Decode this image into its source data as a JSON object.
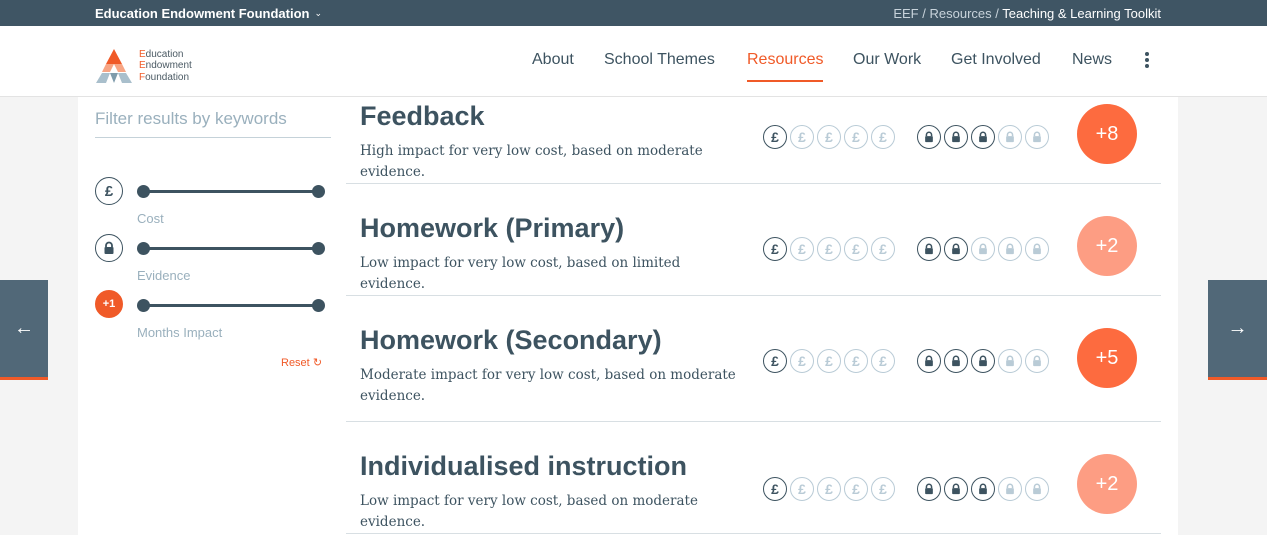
{
  "topbar": {
    "org_name": "Education Endowment Foundation",
    "breadcrumb_eef": "EEF",
    "breadcrumb_resources": "Resources",
    "breadcrumb_current": "Teaching & Learning Toolkit",
    "separator": " / "
  },
  "logo": {
    "line1": "Education",
    "line2": "Endowment",
    "line3": "Foundation",
    "accent": "#f05a28"
  },
  "nav": {
    "about": "About",
    "school_themes": "School Themes",
    "resources": "Resources",
    "our_work": "Our Work",
    "get_involved": "Get Involved",
    "news": "News",
    "active": "Resources"
  },
  "filters": {
    "keyword_placeholder": "Filter results by keywords",
    "cost_icon": "£",
    "cost_label": "Cost",
    "evidence_label": "Evidence",
    "impact_icon": "+1",
    "impact_label": "Months Impact",
    "reset_label": "Reset"
  },
  "icons": {
    "pound": "£",
    "prev_arrow": "←",
    "next_arrow": "→"
  },
  "colors": {
    "accent": "#f05a28",
    "dark": "#3d5360",
    "badge_high": "#fd6b3f",
    "badge_low": "#fd9d83",
    "inactive_icon": "#b9cbd6"
  },
  "results": [
    {
      "title": "Feedback",
      "description": "High impact for very low cost, based on moderate evidence.",
      "cost": 1,
      "evidence": 3,
      "impact": "+8",
      "strength": "high"
    },
    {
      "title": "Homework (Primary)",
      "description": "Low impact for very low cost, based on limited evidence.",
      "cost": 1,
      "evidence": 2,
      "impact": "+2",
      "strength": "low"
    },
    {
      "title": "Homework (Secondary)",
      "description": "Moderate impact for very low cost, based on moderate evidence.",
      "cost": 1,
      "evidence": 3,
      "impact": "+5",
      "strength": "high"
    },
    {
      "title": "Individualised instruction",
      "description": "Low impact for very low cost, based on moderate evidence.",
      "cost": 1,
      "evidence": 3,
      "impact": "+2",
      "strength": "low"
    }
  ]
}
